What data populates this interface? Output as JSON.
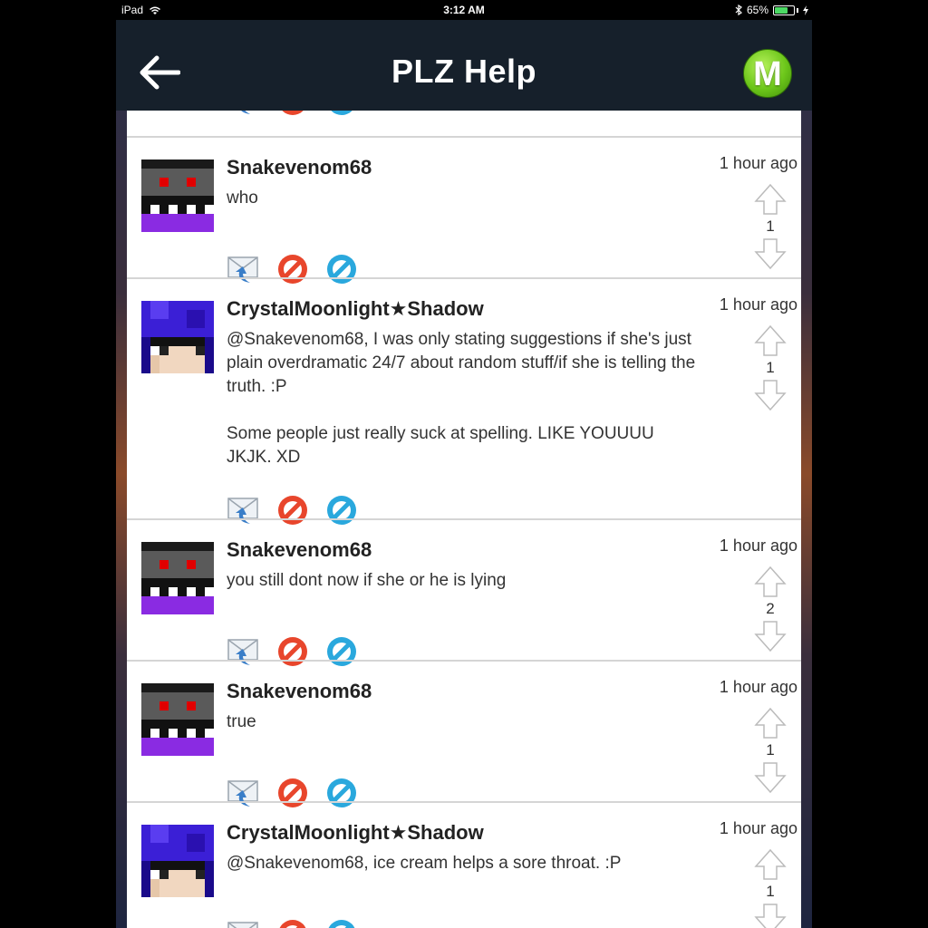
{
  "status_bar": {
    "device": "iPad",
    "time": "3:12 AM",
    "battery": "65%"
  },
  "nav": {
    "title": "PLZ Help",
    "logo_letter": "M",
    "back_icon": "left-arrow-icon"
  },
  "comments": [
    {
      "username": "Snakevenom68",
      "time": "1 hour ago",
      "text": "who",
      "votes": "1",
      "avatar": "snake"
    },
    {
      "username": "CrystalMoonlight★Shadow",
      "time": "1 hour ago",
      "text": "@Snakevenom68, I was only stating suggestions if she's just plain overdramatic 24/7 about random stuff/if she is telling the truth. :P\n\nSome people just really suck at spelling. LIKE YOUUUU JKJK. XD",
      "votes": "1",
      "avatar": "crystal"
    },
    {
      "username": "Snakevenom68",
      "time": "1 hour ago",
      "text": "you still dont now if she or he is lying",
      "votes": "2",
      "avatar": "snake"
    },
    {
      "username": "Snakevenom68",
      "time": "1 hour ago",
      "text": "true",
      "votes": "1",
      "avatar": "snake"
    },
    {
      "username": "CrystalMoonlight★Shadow",
      "time": "1 hour ago",
      "text": "@Snakevenom68, ice cream helps a sore throat. :P",
      "votes": "1",
      "avatar": "crystal"
    }
  ],
  "colors": {
    "nav_bg": "#16202b",
    "brand_green": "#6cc61a",
    "block_red": "#e8462c",
    "flag_blue": "#2aa8dd"
  }
}
